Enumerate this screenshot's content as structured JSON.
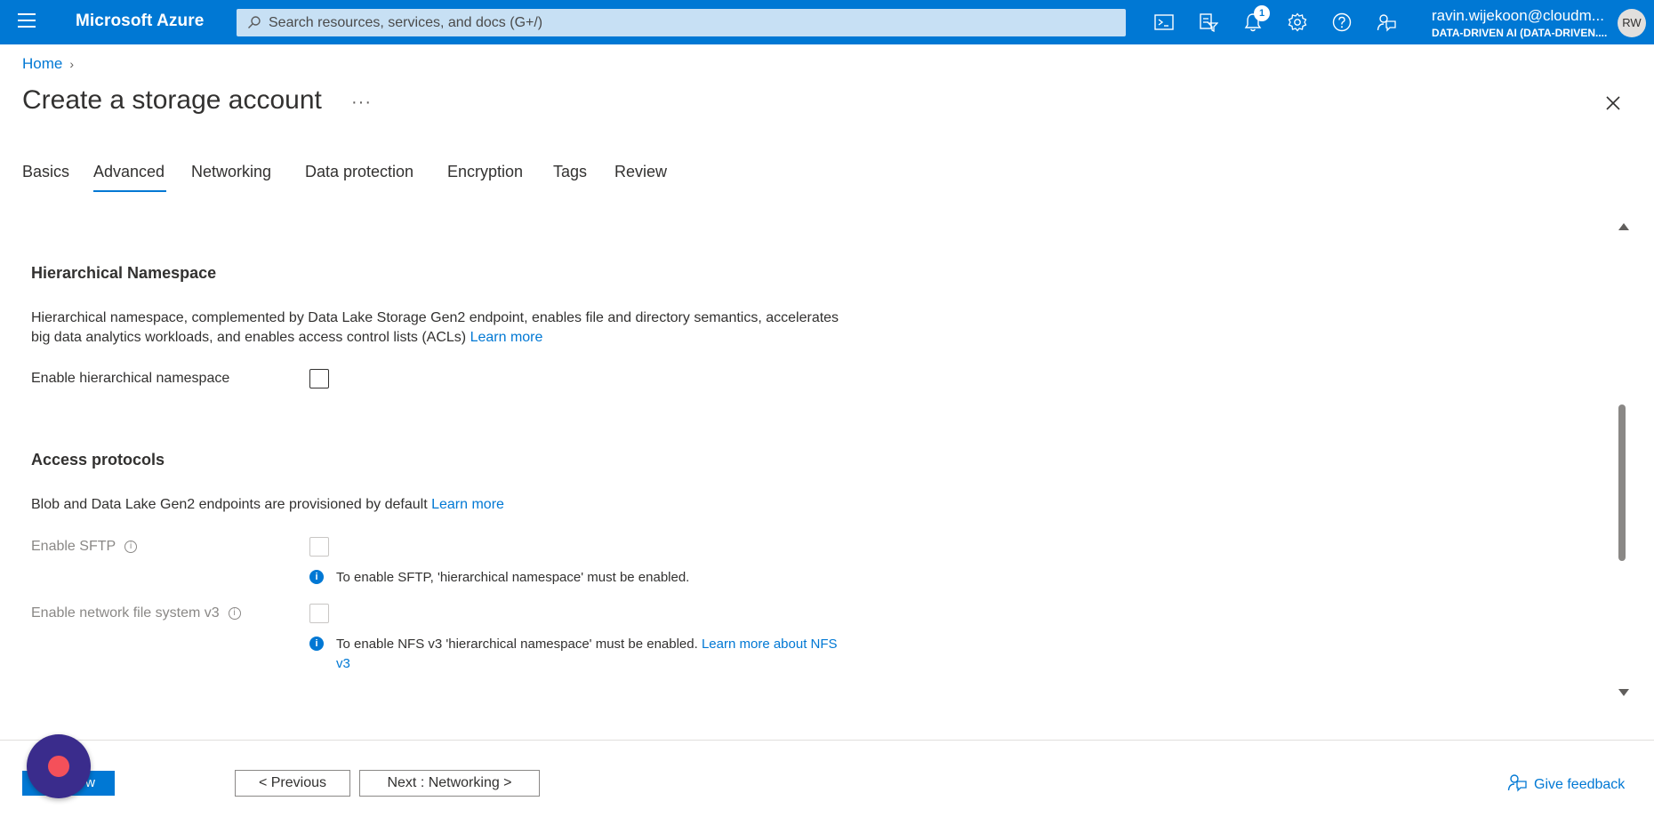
{
  "topbar": {
    "brand": "Microsoft Azure",
    "search_placeholder": "Search resources, services, and docs (G+/)",
    "notification_count": "1",
    "account_email": "ravin.wijekoon@cloudm...",
    "account_tenant": "DATA-DRIVEN AI (DATA-DRIVEN....",
    "avatar_initials": "RW",
    "icons": [
      "cloud-shell-icon",
      "directory-filter-icon",
      "notifications-icon",
      "settings-icon",
      "help-icon",
      "feedback-icon"
    ]
  },
  "header": {
    "breadcrumb_home": "Home",
    "title": "Create a storage account",
    "more": "···"
  },
  "tabs": [
    {
      "label": "Basics"
    },
    {
      "label": "Advanced"
    },
    {
      "label": "Networking"
    },
    {
      "label": "Data protection"
    },
    {
      "label": "Encryption"
    },
    {
      "label": "Tags"
    },
    {
      "label": "Review"
    }
  ],
  "active_tab": "Advanced",
  "hierarchical": {
    "title": "Hierarchical Namespace",
    "desc_line1": "Hierarchical namespace, complemented by Data Lake Storage Gen2 endpoint, enables file and directory semantics, accelerates",
    "desc_line2": "big data analytics workloads, and enables access control lists (ACLs)",
    "learn_more": "Learn more",
    "enable_label": "Enable hierarchical namespace",
    "enable_checked": false
  },
  "access": {
    "title": "Access protocols",
    "desc": "Blob and Data Lake Gen2 endpoints are provisioned by default",
    "learn_more": "Learn more",
    "sftp_label": "Enable SFTP",
    "sftp_note": "To enable SFTP, 'hierarchical namespace' must be enabled.",
    "nfs_label": "Enable network file system v3",
    "nfs_note": "To enable NFS v3 'hierarchical namespace' must be enabled.",
    "nfs_link_1": "Learn more about NFS",
    "nfs_link_2": "v3",
    "info_glyph": "i"
  },
  "footer": {
    "review_label": "w",
    "previous_label": "< Previous",
    "next_label": "Next : Networking >",
    "feedback_label": "Give feedback"
  },
  "colors": {
    "accent": "#0078d4",
    "search_bg": "#c7e0f4",
    "fab": "#3a2c8c",
    "fab_dot": "#f4505a"
  }
}
